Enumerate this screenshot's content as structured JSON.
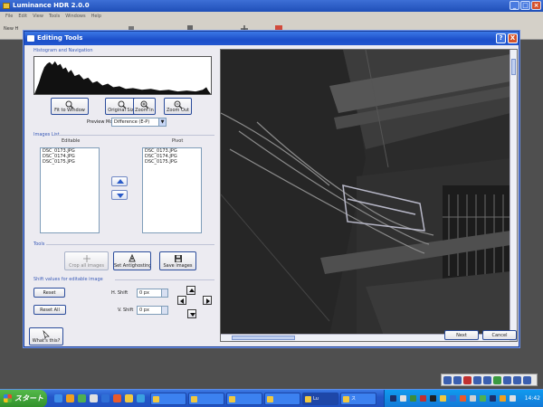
{
  "app": {
    "title": "Luminance HDR 2.0.0",
    "menu": [
      "File",
      "Edit",
      "View",
      "Tools",
      "Windows",
      "Help"
    ],
    "toolbar_first": "New H"
  },
  "dialog": {
    "title": "Editing Tools",
    "help_glyph": "?",
    "close_glyph": "X",
    "histogram_section": "Histogram and Navigation",
    "zoom_buttons": [
      "Fit to Window",
      "Original Size",
      "Zoom In",
      "Zoom Out"
    ],
    "preview_mode_label": "Preview Mode:",
    "preview_mode_value": "Difference (E-P)",
    "images_list_section": "Images List",
    "editable_header": "Editable",
    "pivot_header": "Pivot",
    "editable_items": [
      "DSC_0173.JPG",
      "DSC_0174.JPG",
      "DSC_0175.JPG"
    ],
    "pivot_items": [
      "DSC_0173.JPG",
      "DSC_0174.JPG",
      "DSC_0175.JPG"
    ],
    "tools_section": "Tools",
    "tool_buttons": [
      "Crop all images",
      "Set Antighosting",
      "Save images"
    ],
    "shift_section": "Shift values for editable image",
    "reset_label": "Reset",
    "reset_all_label": "Reset All",
    "h_shift_label": "H. Shift",
    "h_shift_value": "0 px",
    "v_shift_label": "V. Shift",
    "v_shift_value": "0 px",
    "whats_this_label": "What's this?",
    "next_label": "Next",
    "cancel_label": "Cancel"
  },
  "taskbar": {
    "start_label": "スタート",
    "tasks": [
      "",
      "",
      "",
      "",
      "Lu",
      "",
      "ス"
    ],
    "clock": "14:42"
  },
  "colors": {
    "titlebar": "#2a5bd0",
    "button_border": "#2c4d9c",
    "section_label": "#3a5bb8"
  }
}
